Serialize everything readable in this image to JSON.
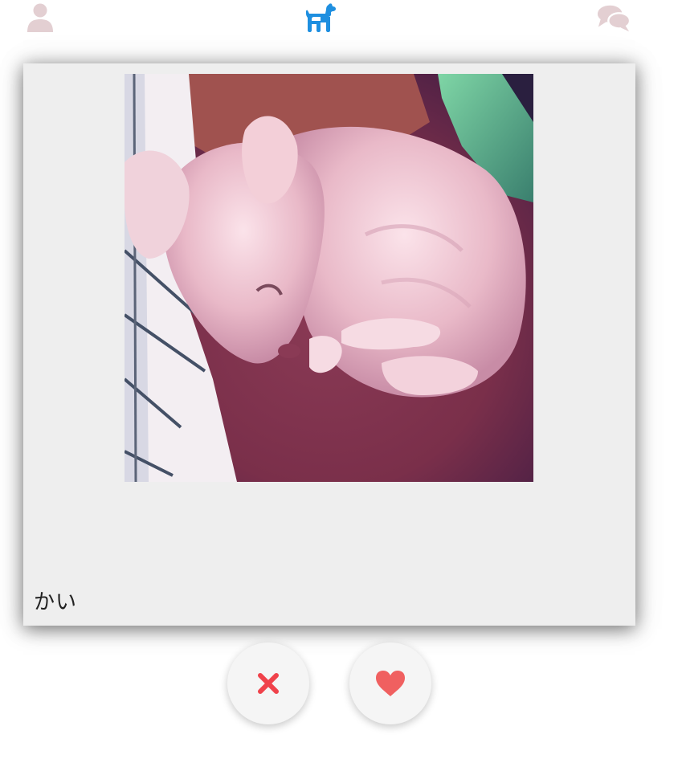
{
  "nav": {
    "items": [
      {
        "icon": "profile-icon",
        "color": "#e3cfd2"
      },
      {
        "icon": "dog-icon",
        "color": "#1e8fe0",
        "active": true
      },
      {
        "icon": "chat-icon",
        "color": "#e3cfd2"
      }
    ]
  },
  "card": {
    "name": "かい",
    "photo_alt": "かい"
  },
  "actions": {
    "nope_color": "#f0424b",
    "like_color": "#f06060"
  }
}
